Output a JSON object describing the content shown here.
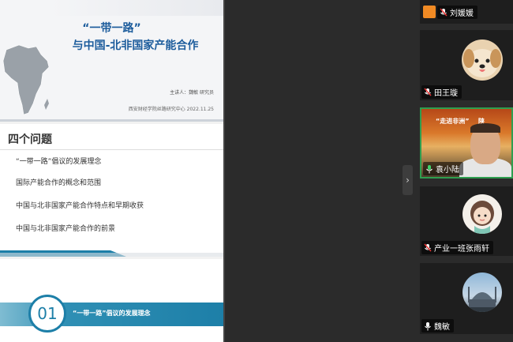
{
  "slides": {
    "slide1": {
      "title_line1": "“一带一路”",
      "title_line2": "与中国-北非国家产能合作",
      "speaker": "主讲人：魏敏 研究员",
      "org_date": "西安财经学院丝路研究中心 2022.11.25"
    },
    "slide2": {
      "heading": "四个问题",
      "items": [
        "“一带一路”倡议的发展理念",
        "国际产能合作的概念和范围",
        "中国与北非国家产能合作特点和早期收获",
        "中国与北非国家产能合作的前景"
      ]
    },
    "slide3": {
      "number": "01",
      "section_title": "“一带一路”倡议的发展理念"
    }
  },
  "participants": [
    {
      "name": "刘媛媛",
      "avatar": "orange-person-icon",
      "mic": "muted"
    },
    {
      "name": "田王璇",
      "avatar": "dog-photo",
      "mic": "muted"
    },
    {
      "name": "袁小陆",
      "avatar": "camera-video",
      "mic": "active",
      "video_banner_left": "“走进非洲”",
      "video_banner_right": "陕"
    },
    {
      "name": "产业一班张雨轩",
      "avatar": "cartoon-girl",
      "mic": "muted"
    },
    {
      "name": "魏敏",
      "avatar": "mosque-photo",
      "mic": "on"
    }
  ],
  "colors": {
    "active_speaker_border": "#2e9e4f",
    "slide_title": "#1c5c9c",
    "section_band": "#1d7fa8"
  },
  "controls": {
    "collapse_icon": "chevron-right-icon"
  }
}
